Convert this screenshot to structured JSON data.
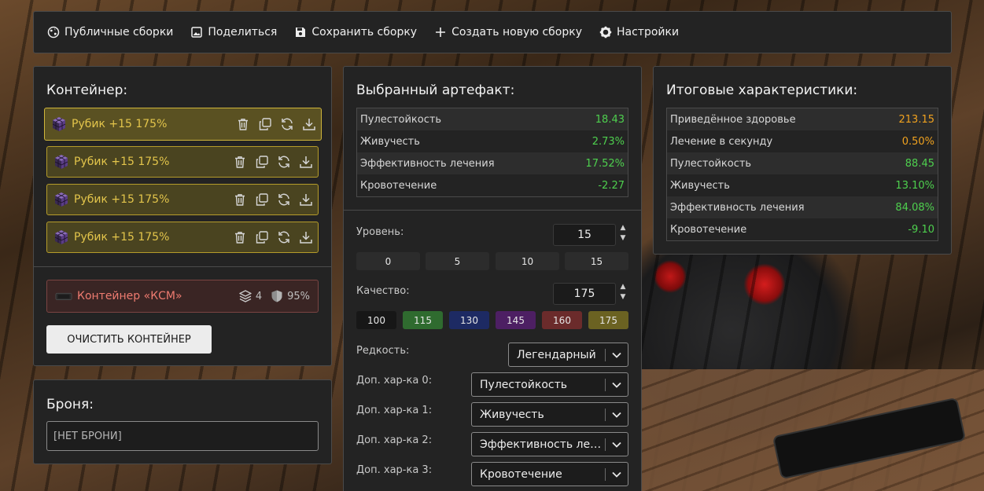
{
  "nav": {
    "public_builds": "Публичные сборки",
    "share": "Поделиться",
    "save_build": "Сохранить сборку",
    "new_build": "Создать новую сборку",
    "settings": "Настройки"
  },
  "container": {
    "title": "Контейнер:",
    "slots": [
      {
        "name": "Рубик +15 175%"
      },
      {
        "name": "Рубик +15 175%"
      },
      {
        "name": "Рубик +15 175%"
      },
      {
        "name": "Рубик +15 175%"
      }
    ],
    "ksm": {
      "name": "Контейнер «КСМ»",
      "slots": "4",
      "protection": "95%"
    },
    "clear_button": "ОЧИСТИТЬ КОНТЕЙНЕР"
  },
  "armor": {
    "title": "Броня:",
    "value": "[НЕТ БРОНИ]"
  },
  "artifact": {
    "title": "Выбранный артефакт:",
    "stats": [
      {
        "label": "Пулестойкость",
        "value": "18.43",
        "color": "#4ed04e"
      },
      {
        "label": "Живучесть",
        "value": "2.73%",
        "color": "#4ed04e"
      },
      {
        "label": "Эффективность лечения",
        "value": "17.52%",
        "color": "#4ed04e"
      },
      {
        "label": "Кровотечение",
        "value": "-2.27",
        "color": "#4ed04e"
      }
    ],
    "level_label": "Уровень:",
    "level_value": "15",
    "level_presets": [
      "0",
      "5",
      "10",
      "15"
    ],
    "quality_label": "Качество:",
    "quality_value": "175",
    "quality_presets": [
      {
        "label": "100",
        "color": "#171717"
      },
      {
        "label": "115",
        "color": "#2f6b2f"
      },
      {
        "label": "130",
        "color": "#1d2a63"
      },
      {
        "label": "145",
        "color": "#4d1f63"
      },
      {
        "label": "160",
        "color": "#6b2b2b"
      },
      {
        "label": "175",
        "color": "#6b6222"
      }
    ],
    "rarity_label": "Редкость:",
    "rarity_value": "Легендарный",
    "extra": [
      {
        "label": "Доп. хар-ка 0:",
        "value": "Пулестойкость"
      },
      {
        "label": "Доп. хар-ка 1:",
        "value": "Живучесть"
      },
      {
        "label": "Доп. хар-ка 2:",
        "value": "Эффективность лечения"
      },
      {
        "label": "Доп. хар-ка 3:",
        "value": "Кровотечение"
      }
    ]
  },
  "totals": {
    "title": "Итоговые характеристики:",
    "stats": [
      {
        "label": "Приведённое здоровье",
        "value": "213.15",
        "color": "#f0a21f"
      },
      {
        "label": "Лечение в секунду",
        "value": "0.50%",
        "color": "#f0a21f"
      },
      {
        "label": "Пулестойкость",
        "value": "88.45",
        "color": "#4ed04e"
      },
      {
        "label": "Живучесть",
        "value": "13.10%",
        "color": "#4ed04e"
      },
      {
        "label": "Эффективность лечения",
        "value": "84.08%",
        "color": "#4ed04e"
      },
      {
        "label": "Кровотечение",
        "value": "-9.10",
        "color": "#4ed04e"
      }
    ]
  }
}
